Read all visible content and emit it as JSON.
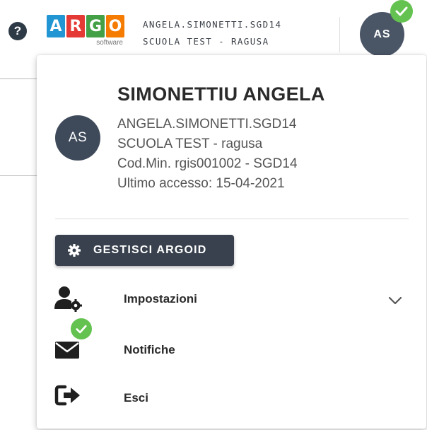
{
  "header": {
    "help_icon": "question-circle-icon",
    "help_glyph": "?",
    "logo": {
      "letters": [
        "A",
        "R",
        "G",
        "O"
      ],
      "colors": [
        "#2196d3",
        "#e53935",
        "#43a047",
        "#f57c00"
      ],
      "subtitle": "software"
    },
    "username": "ANGELA.SIMONETTI.SGD14",
    "school": "SCUOLA TEST - RAGUSA",
    "avatar_initials": "AS",
    "status_icon": "check-icon",
    "status_color": "#63c250"
  },
  "profile": {
    "avatar_initials": "AS",
    "full_name": "SIMONETTIU ANGELA",
    "username": "ANGELA.SIMONETTI.SGD14",
    "school": "SCUOLA TEST - ragusa",
    "codmin": "Cod.Min. rgis001002 - SGD14",
    "last_access": "Ultimo accesso: 15-04-2021"
  },
  "manage_button": {
    "label": "GESTISCI ARGOID",
    "icon": "gear-icon",
    "color": "#38414d"
  },
  "menu": [
    {
      "label": "Impostazioni",
      "icon": "user-settings-icon",
      "expandable": true
    },
    {
      "label": "Notifiche",
      "icon": "envelope-check-icon"
    },
    {
      "label": "Esci",
      "icon": "sign-out-icon"
    }
  ]
}
